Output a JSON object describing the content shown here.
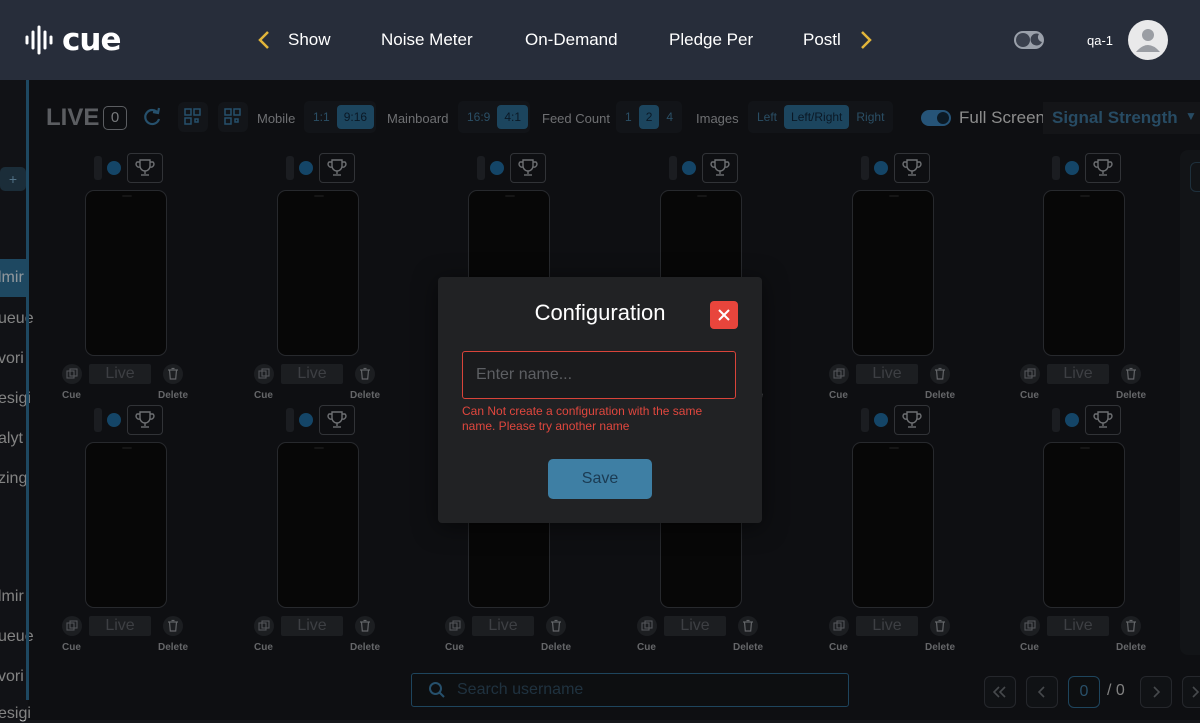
{
  "app": {
    "logo_text": "cue"
  },
  "nav": {
    "items": [
      "Show",
      "Noise Meter",
      "On-Demand",
      "Pledge Per",
      "Postl"
    ],
    "prev_icon": "chevron-left-icon",
    "next_icon": "chevron-right-icon"
  },
  "user": {
    "name": "qa-1"
  },
  "sidebar": {
    "plus_label": "+",
    "items_top": [
      "lmir",
      "ueue",
      "vori",
      "esigi",
      "alyt",
      "zing"
    ],
    "items_bottom": [
      "lmir",
      "ueue",
      "vori",
      "esigi"
    ]
  },
  "toolbar": {
    "live_label": "LIVE",
    "live_count": "0",
    "mobile_label": "Mobile",
    "mobile_options": [
      "1:1",
      "9:16"
    ],
    "mainboard_label": "Mainboard",
    "mainboard_options": [
      "16:9",
      "4:1"
    ],
    "feed_count_label": "Feed Count",
    "feed_count_options": [
      "1",
      "2",
      "4"
    ],
    "images_label": "Images",
    "images_options": [
      "Left",
      "Left/Right",
      "Right"
    ],
    "fullscreen_label": "Full Screen",
    "signal_label": "Signal Strength"
  },
  "cell": {
    "live_label": "Live",
    "cue_label": "Cue",
    "delete_label": "Delete"
  },
  "search": {
    "placeholder": "Search username"
  },
  "pagination": {
    "current": "0",
    "total": "/ 0"
  },
  "modal": {
    "title": "Configuration",
    "input_placeholder": "Enter name...",
    "input_value": "",
    "error": "Can Not create a configuration with the same name. Please try another name",
    "save_label": "Save"
  },
  "colors": {
    "accent": "#2f6f96",
    "error": "#e0473e",
    "close_button": "#e8453c",
    "topbar": "#272d3a"
  }
}
